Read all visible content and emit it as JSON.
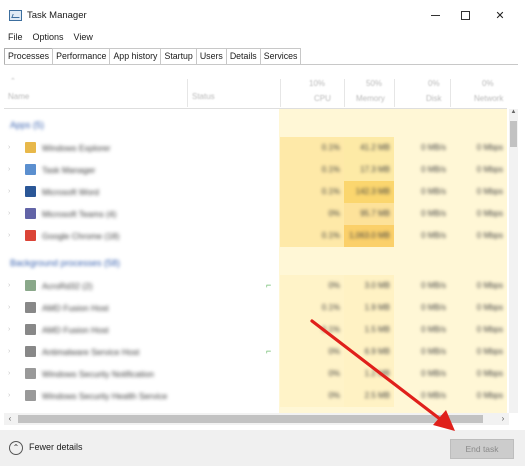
{
  "window": {
    "title": "Task Manager",
    "controls": {
      "minimize": "",
      "maximize": "",
      "close": "✕"
    }
  },
  "menu": [
    "File",
    "Options",
    "View"
  ],
  "tabs": [
    {
      "label": "Processes",
      "active": true
    },
    {
      "label": "Performance",
      "active": false
    },
    {
      "label": "App history",
      "active": false
    },
    {
      "label": "Startup",
      "active": false
    },
    {
      "label": "Users",
      "active": false
    },
    {
      "label": "Details",
      "active": false
    },
    {
      "label": "Services",
      "active": false
    }
  ],
  "header": {
    "name": "Name",
    "status": "Status",
    "cpu_pct": "10%",
    "cpu": "CPU",
    "memory_pct": "50%",
    "memory": "Memory",
    "disk_pct": "0%",
    "disk": "Disk",
    "network_pct": "0%",
    "network": "Network"
  },
  "groups": [
    {
      "name": "Apps (5)",
      "rows": [
        {
          "name": "Windows Explorer",
          "cpu": "0.1%",
          "memory": "41.2 MB",
          "disk": "0 MB/s",
          "network": "0 Mbps",
          "icon_color": "#e8b84a",
          "mem_highlight": "#fdeaa6"
        },
        {
          "name": "Task Manager",
          "cpu": "0.1%",
          "memory": "17.3 MB",
          "disk": "0 MB/s",
          "network": "0 Mbps",
          "icon_color": "#5b8fcf",
          "mem_highlight": "#fdeaa6"
        },
        {
          "name": "Microsoft Word",
          "cpu": "0.1%",
          "memory": "142.3 MB",
          "disk": "0 MB/s",
          "network": "0 Mbps",
          "icon_color": "#2b5797",
          "mem_highlight": "#fbd66e"
        },
        {
          "name": "Microsoft Teams (4)",
          "cpu": "0%",
          "memory": "95.7 MB",
          "disk": "0 MB/s",
          "network": "0 Mbps",
          "icon_color": "#6264a7",
          "mem_highlight": "#fde29a"
        },
        {
          "name": "Google Chrome (18)",
          "cpu": "0.1%",
          "memory": "1,063.0 MB",
          "disk": "0 MB/s",
          "network": "0 Mbps",
          "icon_color": "#db4437",
          "mem_highlight": "#fbd06a"
        }
      ]
    },
    {
      "name": "Background processes (58)",
      "rows": [
        {
          "name": "AcroRd32 (2)",
          "cpu": "0%",
          "memory": "3.0 MB",
          "disk": "0 MB/s",
          "network": "0 Mbps",
          "icon_color": "#8aa88a",
          "mem_highlight": "#fff2c4",
          "leaf": true
        },
        {
          "name": "AMD Fusion Host",
          "cpu": "0.1%",
          "memory": "1.9 MB",
          "disk": "0 MB/s",
          "network": "0 Mbps",
          "icon_color": "#888888",
          "mem_highlight": "#fff2c4"
        },
        {
          "name": "AMD Fusion Host",
          "cpu": "0.1%",
          "memory": "1.5 MB",
          "disk": "0 MB/s",
          "network": "0 Mbps",
          "icon_color": "#888888",
          "mem_highlight": "#fff2c4"
        },
        {
          "name": "Antimalware Service Host",
          "cpu": "0%",
          "memory": "6.9 MB",
          "disk": "0 MB/s",
          "network": "0 Mbps",
          "icon_color": "#888888",
          "mem_highlight": "#fff2c4",
          "leaf": true
        },
        {
          "name": "Windows Security Notification",
          "cpu": "0%",
          "memory": "1.2 MB",
          "disk": "0 MB/s",
          "network": "0 Mbps",
          "icon_color": "#999999",
          "mem_highlight": "#fff2c4"
        },
        {
          "name": "Windows Security Health Service",
          "cpu": "0%",
          "memory": "2.5 MB",
          "disk": "0 MB/s",
          "network": "0 Mbps",
          "icon_color": "#999999",
          "mem_highlight": "#fff2c4"
        }
      ]
    }
  ],
  "footer": {
    "fewer_details": "Fewer details",
    "end_task": "End task"
  },
  "annotation_color": "#e0201b"
}
